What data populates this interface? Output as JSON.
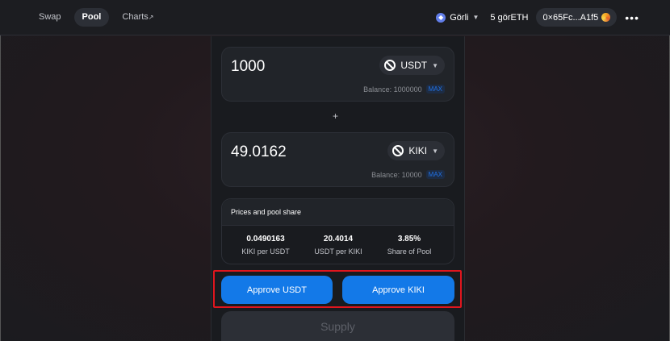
{
  "nav": {
    "swap": "Swap",
    "pool": "Pool",
    "charts": "Charts",
    "charts_arrow": "↗"
  },
  "header": {
    "network": "Görli",
    "network_icon": "ethereum-icon",
    "balance": "5 görETH",
    "address": "0×65Fc...A1f5",
    "more": "•••"
  },
  "input_a": {
    "amount": "1000",
    "token": "USDT",
    "balance": "Balance: 1000000",
    "max": "MAX"
  },
  "plus": "+",
  "input_b": {
    "amount": "49.0162",
    "token": "KIKI",
    "balance": "Balance: 10000",
    "max": "MAX"
  },
  "prices": {
    "title": "Prices and pool share",
    "stats": [
      {
        "value": "0.0490163",
        "label": "KIKI per USDT"
      },
      {
        "value": "20.4014",
        "label": "USDT per KIKI"
      },
      {
        "value": "3.85%",
        "label": "Share of Pool"
      }
    ]
  },
  "actions": {
    "approve_a": "Approve USDT",
    "approve_b": "Approve KIKI",
    "supply": "Supply"
  },
  "colors": {
    "accent": "#1379e8",
    "highlight": "#e0161e",
    "background": "#191b1f"
  }
}
